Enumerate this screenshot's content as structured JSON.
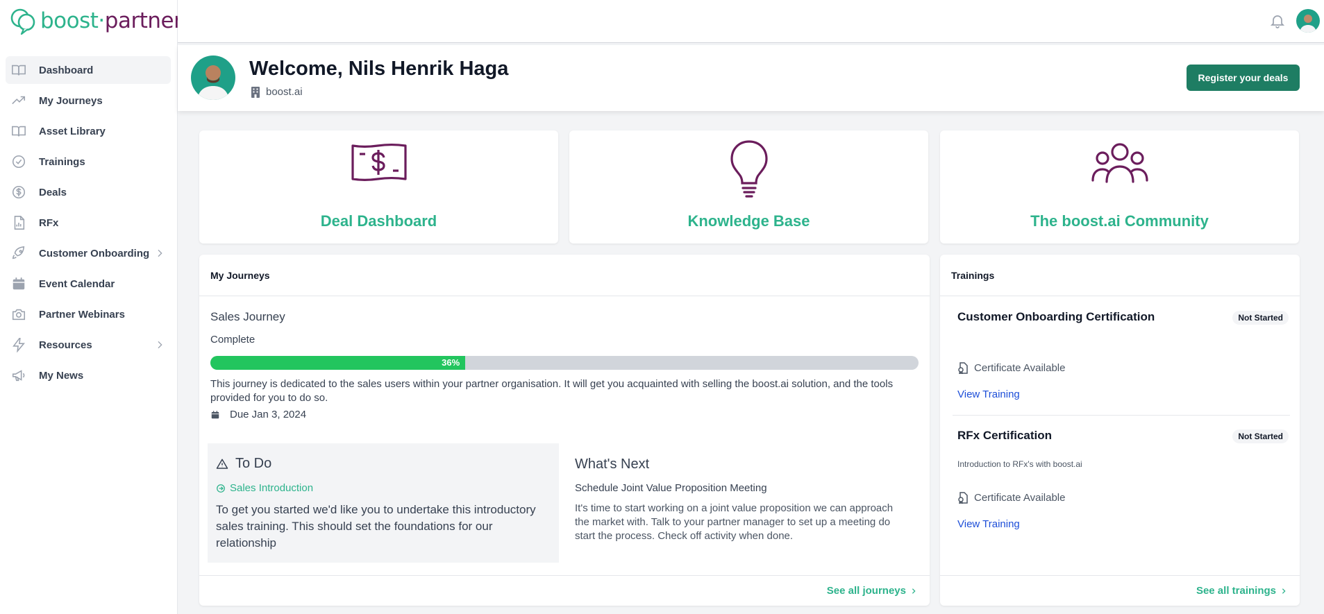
{
  "brand": {
    "logo_prefix": "boost",
    "logo_dot": "·",
    "logo_suffix": "partner"
  },
  "sidebar": {
    "items": [
      {
        "label": "Dashboard",
        "icon": "book-open-icon"
      },
      {
        "label": "My Journeys",
        "icon": "trending-up-icon"
      },
      {
        "label": "Asset Library",
        "icon": "book-icon"
      },
      {
        "label": "Trainings",
        "icon": "check-circle-icon"
      },
      {
        "label": "Deals",
        "icon": "dollar-circle-icon"
      },
      {
        "label": "RFx",
        "icon": "document-chart-icon"
      },
      {
        "label": "Customer Onboarding",
        "icon": "rocket-icon"
      },
      {
        "label": "Event Calendar",
        "icon": "calendar-icon"
      },
      {
        "label": "Partner Webinars",
        "icon": "camera-icon"
      },
      {
        "label": "Resources",
        "icon": "lightning-icon"
      },
      {
        "label": "My News",
        "icon": "megaphone-icon"
      }
    ]
  },
  "header": {
    "welcome": "Welcome, Nils Henrik Haga",
    "company": "boost.ai",
    "register_button": "Register your deals"
  },
  "tiles": {
    "deal": "Deal Dashboard",
    "knowledge": "Knowledge Base",
    "community": "The boost.ai Community"
  },
  "journeys": {
    "heading": "My Journeys",
    "name": "Sales Journey",
    "status": "Complete",
    "progress_percent": 36,
    "progress_label": "36%",
    "description": "This journey is dedicated to the sales users within your partner organisation. It will get you acquainted with selling the boost.ai solution, and the tools provided for you to do so.",
    "due": "Due Jan 3, 2024",
    "todo": {
      "title": "To Do",
      "link": "Sales Introduction",
      "text": "To get you started we'd like you to undertake this introductory sales training. This should set the foundations for our relationship"
    },
    "next": {
      "title": "What's Next",
      "subtitle": "Schedule Joint Value Proposition Meeting",
      "text": "It's time to start working on a joint value proposition we can approach the market with. Talk to your partner manager to set up a meeting do start the process. Check off activity when done."
    },
    "see_all": "See all journeys"
  },
  "trainings": {
    "heading": "Trainings",
    "items": [
      {
        "title": "Customer Onboarding Certification",
        "badge": "Not Started",
        "description": "",
        "certificate": "Certificate Available",
        "link": "View Training"
      },
      {
        "title": "RFx Certification",
        "badge": "Not Started",
        "description": "Introduction to RFx's with boost.ai",
        "certificate": "Certificate Available",
        "link": "View Training"
      }
    ],
    "see_all": "See all trainings"
  },
  "colors": {
    "accent_green": "#2db38c",
    "brand_purple": "#6b1d5c",
    "button_green": "#1e7d63",
    "progress_green": "#22c55e"
  }
}
